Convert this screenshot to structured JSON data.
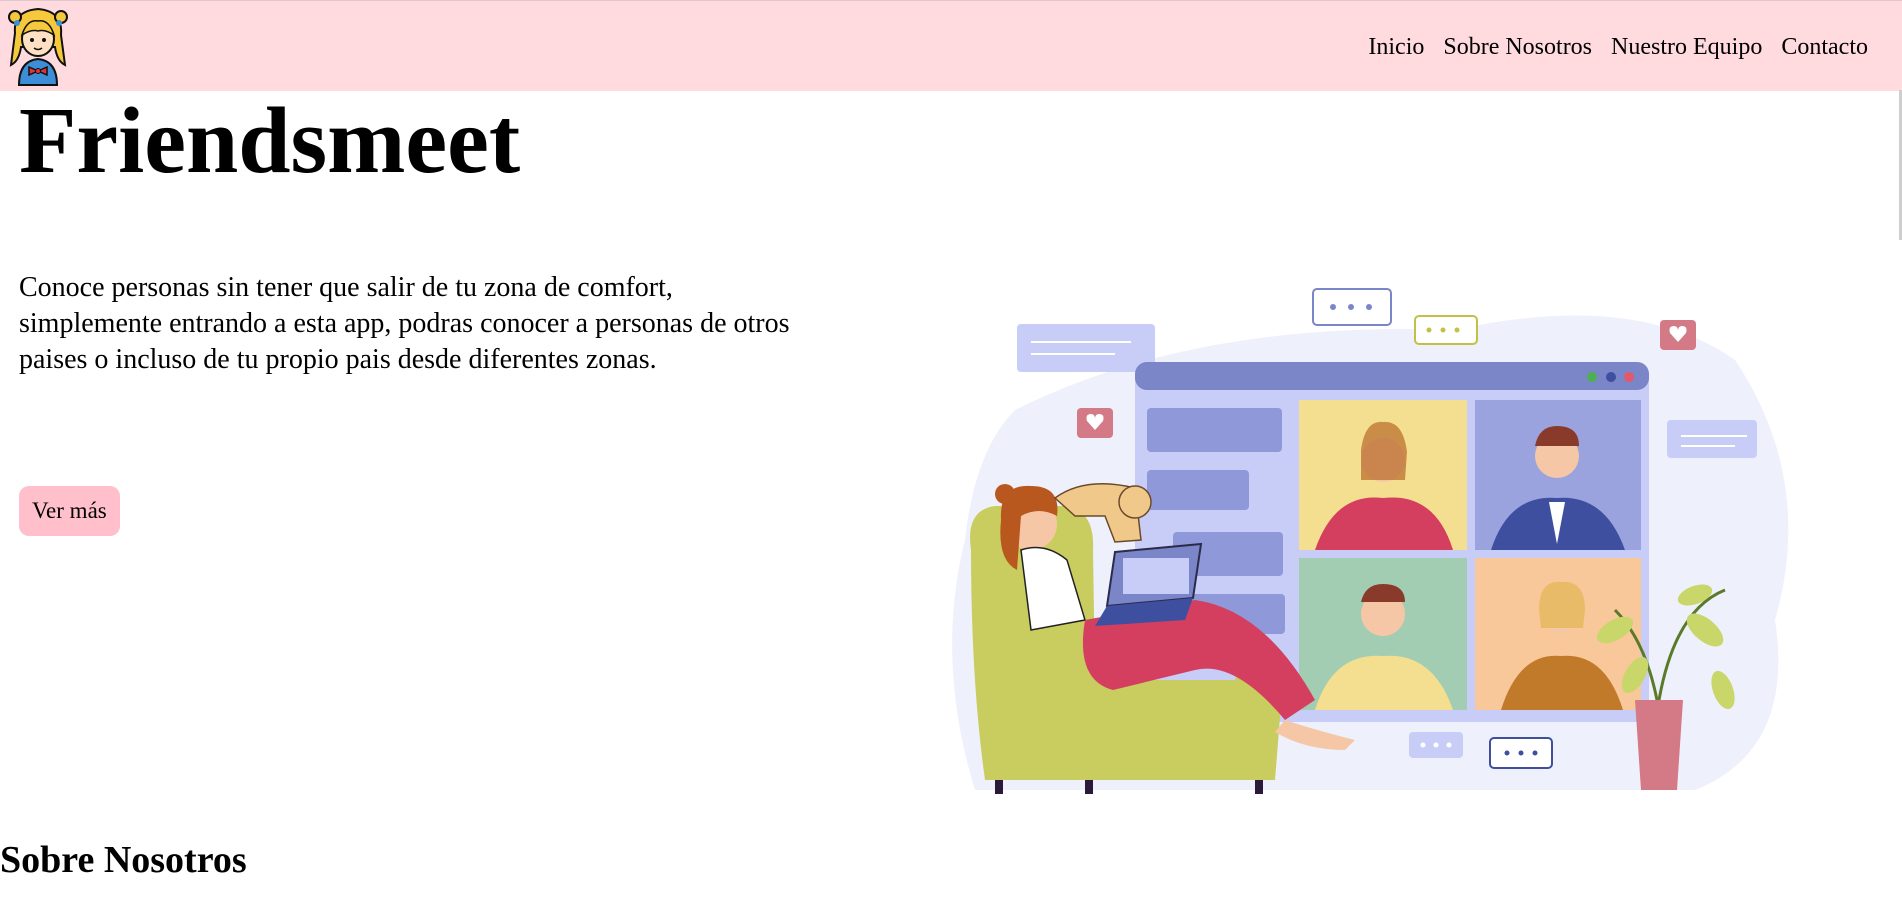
{
  "header": {
    "logo_icon": "girl-avatar-icon",
    "nav": [
      {
        "label": "Inicio"
      },
      {
        "label": "Sobre Nosotros"
      },
      {
        "label": "Nuestro Equipo"
      },
      {
        "label": "Contacto"
      }
    ],
    "background_color": "#ffdbe0"
  },
  "hero": {
    "title": "Friendsmeet",
    "text": "Conoce personas sin tener que salir de tu zona de comfort, simplemente entrando a esta app, podras conocer a personas de otros paises o incluso de tu propio pais desde diferentes zonas.",
    "button_label": "Ver más",
    "button_color": "#ffc0cb",
    "illustration_icon": "video-call-illustration"
  },
  "about": {
    "title": "Sobre Nosotros"
  }
}
